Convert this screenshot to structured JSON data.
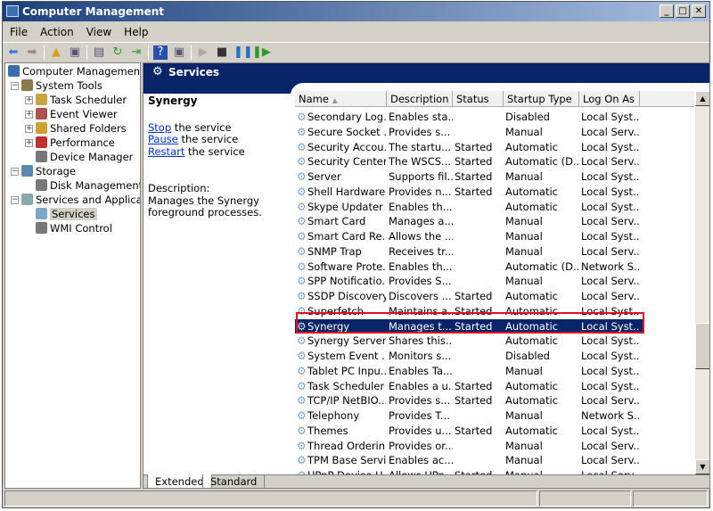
{
  "window": {
    "title": "Computer Management"
  },
  "menu": [
    "File",
    "Action",
    "View",
    "Help"
  ],
  "tree": [
    {
      "label": "Computer Management (L",
      "level": 0
    },
    {
      "label": "System Tools",
      "level": 1,
      "expander": "−"
    },
    {
      "label": "Task Scheduler",
      "level": 2,
      "expander": "+"
    },
    {
      "label": "Event Viewer",
      "level": 2,
      "expander": "+"
    },
    {
      "label": "Shared Folders",
      "level": 2,
      "expander": "+"
    },
    {
      "label": "Performance",
      "level": 2,
      "expander": "+"
    },
    {
      "label": "Device Manager",
      "level": 2
    },
    {
      "label": "Storage",
      "level": 1,
      "expander": "−"
    },
    {
      "label": "Disk Management",
      "level": 2
    },
    {
      "label": "Services and Applications",
      "level": 1,
      "expander": "−"
    },
    {
      "label": "Services",
      "level": 2,
      "selected": true
    },
    {
      "label": "WMI Control",
      "level": 2
    }
  ],
  "panel": {
    "title": "Services",
    "service_name": "Synergy",
    "actions": [
      {
        "link": "Stop",
        "rest": " the service"
      },
      {
        "link": "Pause",
        "rest": " the service"
      },
      {
        "link": "Restart",
        "rest": " the service"
      }
    ],
    "desc_label": "Description:",
    "desc_text": "Manages the Synergy foreground processes."
  },
  "columns": [
    "Name",
    "Description",
    "Status",
    "Startup Type",
    "Log On As"
  ],
  "rows": [
    [
      "Secondary Log...",
      "Enables sta...",
      "",
      "Disabled",
      "Local Syst..."
    ],
    [
      "Secure Socket ...",
      "Provides s...",
      "",
      "Manual",
      "Local Serv..."
    ],
    [
      "Security Accou...",
      "The startu...",
      "Started",
      "Automatic",
      "Local Syst..."
    ],
    [
      "Security Center",
      "The WSCS...",
      "Started",
      "Automatic (D...",
      "Local Serv..."
    ],
    [
      "Server",
      "Supports fil...",
      "Started",
      "Manual",
      "Local Syst..."
    ],
    [
      "Shell Hardware ...",
      "Provides n...",
      "Started",
      "Automatic",
      "Local Syst..."
    ],
    [
      "Skype Updater",
      "Enables th...",
      "",
      "Automatic",
      "Local Syst..."
    ],
    [
      "Smart Card",
      "Manages a...",
      "",
      "Manual",
      "Local Serv..."
    ],
    [
      "Smart Card Re...",
      "Allows the ...",
      "",
      "Manual",
      "Local Syst..."
    ],
    [
      "SNMP Trap",
      "Receives tr...",
      "",
      "Manual",
      "Local Serv..."
    ],
    [
      "Software Prote...",
      "Enables th...",
      "",
      "Automatic (D...",
      "Network S..."
    ],
    [
      "SPP Notificatio...",
      "Provides S...",
      "",
      "Manual",
      "Local Serv..."
    ],
    [
      "SSDP Discovery",
      "Discovers ...",
      "Started",
      "Automatic",
      "Local Serv..."
    ],
    [
      "Superfetch",
      "Maintains a...",
      "Started",
      "Automatic",
      "Local Syst..."
    ],
    [
      "Synergy",
      "Manages t...",
      "Started",
      "Automatic",
      "Local Syst..."
    ],
    [
      "Synergy Server",
      "Shares this...",
      "",
      "Automatic",
      "Local Syst..."
    ],
    [
      "System Event ...",
      "Monitors s...",
      "",
      "Disabled",
      "Local Syst..."
    ],
    [
      "Tablet PC Inpu...",
      "Enables Ta...",
      "",
      "Manual",
      "Local Syst..."
    ],
    [
      "Task Scheduler",
      "Enables a u...",
      "Started",
      "Automatic",
      "Local Syst..."
    ],
    [
      "TCP/IP NetBIO...",
      "Provides s...",
      "Started",
      "Automatic",
      "Local Serv..."
    ],
    [
      "Telephony",
      "Provides T...",
      "",
      "Manual",
      "Network S..."
    ],
    [
      "Themes",
      "Provides u...",
      "Started",
      "Automatic",
      "Local Syst..."
    ],
    [
      "Thread Orderin...",
      "Provides or...",
      "",
      "Manual",
      "Local Serv..."
    ],
    [
      "TPM Base Servi...",
      "Enables ac...",
      "",
      "Manual",
      "Local Serv..."
    ],
    [
      "UPnP Device H...",
      "Allows UPn...",
      "Started",
      "Manual",
      "Local Serv..."
    ]
  ],
  "selected_row": 14,
  "tabs": [
    "Extended",
    "Standard"
  ]
}
